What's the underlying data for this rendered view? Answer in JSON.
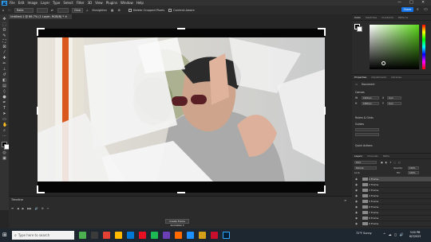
{
  "app": {
    "logo": "Ps",
    "menu": [
      "File",
      "Edit",
      "Image",
      "Layer",
      "Type",
      "Select",
      "Filter",
      "3D",
      "View",
      "Plugins",
      "Window",
      "Help"
    ],
    "window_controls": [
      "—",
      "□",
      "✕"
    ]
  },
  "options_bar": {
    "ratio_value": "Ratio",
    "clear_label": "Clear",
    "straighten_label": "Straighten",
    "delete_cropped_label": "Delete Cropped Pixels",
    "content_aware_label": "Content-Aware",
    "share_label": "Share"
  },
  "document": {
    "tab_title": "Untitled-1 @ 66.7% (1 Layer, RGB/8) *  ✕"
  },
  "timeline": {
    "title": "Timeline",
    "controls": [
      "⏮",
      "◀",
      "▶",
      "▶▶",
      "🔊",
      "⚙",
      "✂"
    ],
    "create_button": "Create Frame Animation ▾"
  },
  "panels": {
    "color_tabs": [
      "Color",
      "Swatches",
      "Gradients",
      "Patterns"
    ],
    "properties_tabs": [
      "Properties",
      "Adjustments",
      "Libraries"
    ],
    "doc_label": "Document",
    "canvas_label": "Canvas",
    "canvas_w": "1920 px",
    "canvas_h": "1080 px",
    "canvas_x": "0 px",
    "canvas_y": "0 px",
    "rulers_label": "Rulers & Grids",
    "guides_label": "Guides",
    "quick_actions_label": "Quick Actions",
    "layers_tabs": [
      "Layers",
      "Channels",
      "Paths"
    ],
    "layer_kind": "Kind",
    "blend_mode": "Normal",
    "opacity_label": "Opacity:",
    "opacity_value": "100%",
    "lock_label": "Lock:",
    "fill_label": "Fill:",
    "fill_value": "100%",
    "layers": [
      "1 Frame",
      "2 Frame",
      "3 Frame",
      "4 Frame",
      "5 Frame",
      "6 Frame",
      "7 Frame",
      "8 Frame",
      "9 Frame"
    ]
  },
  "taskbar": {
    "search_placeholder": "Type here to search",
    "weather": "72°F  Sunny",
    "time": "3:00 PM",
    "date": "6/7/2023"
  },
  "colors": {
    "accent": "#1473e6",
    "ps_blue": "#31a8ff",
    "chrome_dark": "#262626",
    "panel": "#2b2b2b"
  }
}
